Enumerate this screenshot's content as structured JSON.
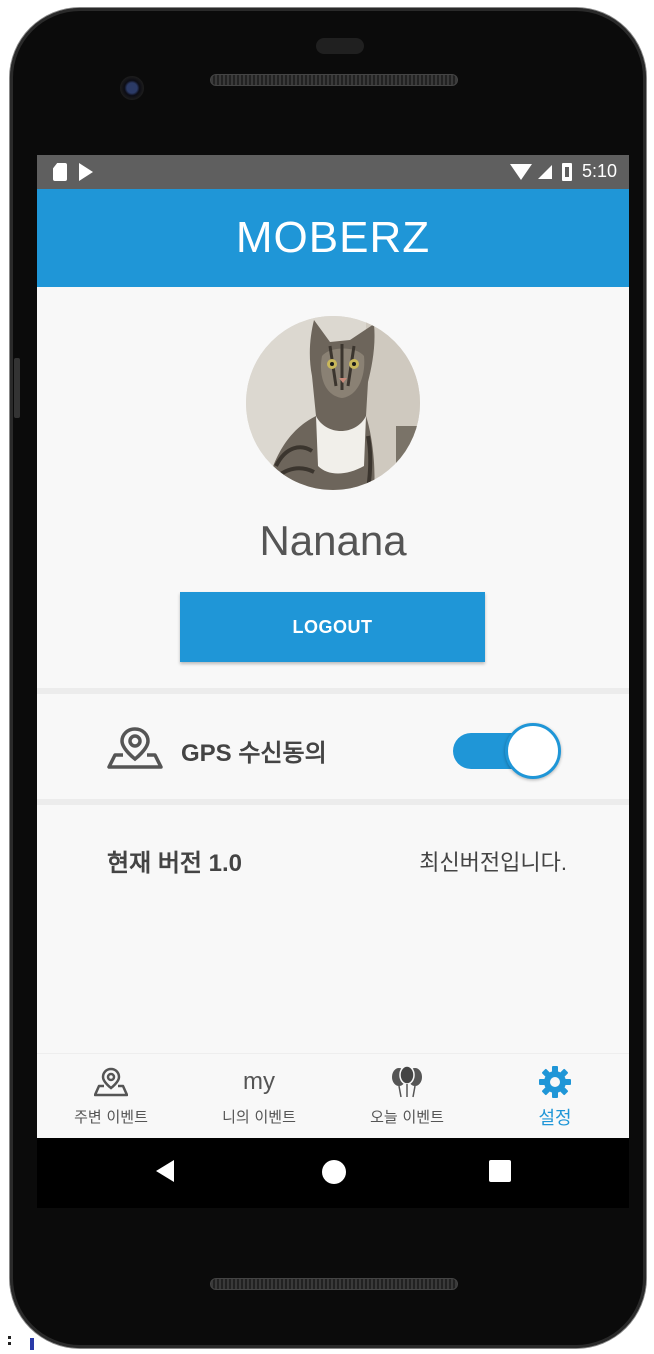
{
  "status_bar": {
    "time": "5:10"
  },
  "app_bar": {
    "title": "MOBERZ"
  },
  "profile": {
    "name": "Nanana",
    "logout_label": "LOGOUT"
  },
  "settings": {
    "gps": {
      "label": "GPS 수신동의",
      "enabled": true
    },
    "version": {
      "label": "현재 버전 1.0",
      "status": "최신버전입니다."
    }
  },
  "bottom_nav": {
    "items": [
      {
        "label": "주변 이벤트",
        "icon": "map-pin-icon",
        "active": false
      },
      {
        "label": "니의 이벤트",
        "icon_text": "my",
        "active": false
      },
      {
        "label": "오늘 이벤트",
        "icon": "balloons-icon",
        "active": false
      },
      {
        "label": "설정",
        "icon": "gear-icon",
        "active": true
      }
    ]
  },
  "colors": {
    "accent": "#1f96d7",
    "status_bar": "#5f5f5f",
    "background": "#f8f8f8"
  }
}
